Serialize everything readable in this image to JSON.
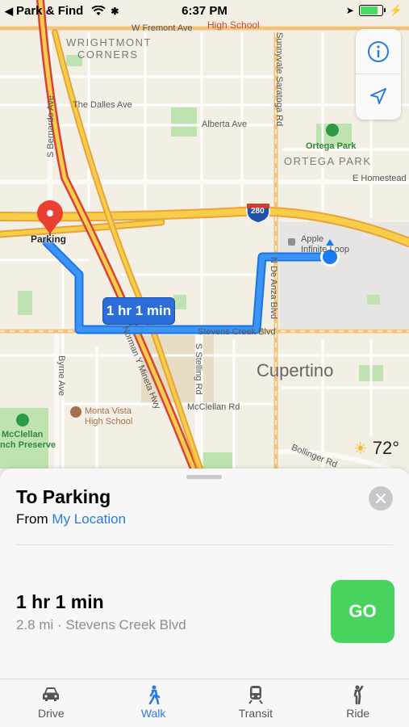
{
  "status_bar": {
    "back_app": "Park & Find",
    "time": "6:37 PM",
    "battery_level": 0.9
  },
  "map": {
    "labels": {
      "fremont_ave": "W Fremont Ave",
      "high_school": "High School",
      "sunnyvale_saratoga": "Sunnyvale Saratoga Rd",
      "wrightmont": "WRIGHTMONT",
      "corners": "CORNERS",
      "the_dalles": "The Dalles Ave",
      "alberta": "Alberta Ave",
      "s_bernardo": "S Bernardo Ave",
      "ortega_park": "Ortega Park",
      "ortega_park_region": "ORTEGA PARK",
      "e_homestead": "E Homestead",
      "highway_280": "280",
      "apple": "Apple",
      "infinite_loop": "Infinite Loop",
      "n_de_anza": "N De Anza Blvd",
      "stevens_creek": "Stevens Creek Blvd",
      "byrne": "Byrne Ave",
      "s_stelling": "S Stelling Rd",
      "norman_mineta": "Norman Y Mineta Hwy",
      "cupertino": "Cupertino",
      "monta_vista_1": "Monta Vista",
      "monta_vista_2": "High School",
      "mcclellan_rd": "McClellan Rd",
      "mcclellan_1": "McClellan",
      "mcclellan_2": "nch Preserve",
      "bollinger": "Bollinger Rd"
    },
    "pin_label": "Parking",
    "route_time": "1 hr 1 min",
    "temperature": "72°"
  },
  "sheet": {
    "title": "To Parking",
    "from_prefix": "From",
    "from_link": "My Location",
    "duration": "1 hr 1 min",
    "distance": "2.8 mi · Stevens Creek Blvd",
    "go_label": "GO"
  },
  "tabs": [
    {
      "label": "Drive",
      "icon": "car-icon"
    },
    {
      "label": "Walk",
      "icon": "walk-icon"
    },
    {
      "label": "Transit",
      "icon": "train-icon"
    },
    {
      "label": "Ride",
      "icon": "ride-icon"
    }
  ],
  "colors": {
    "accent": "#2b7be0",
    "go": "#48d35f",
    "route": "#2f8ff0",
    "freeway": "#f5c04a"
  }
}
